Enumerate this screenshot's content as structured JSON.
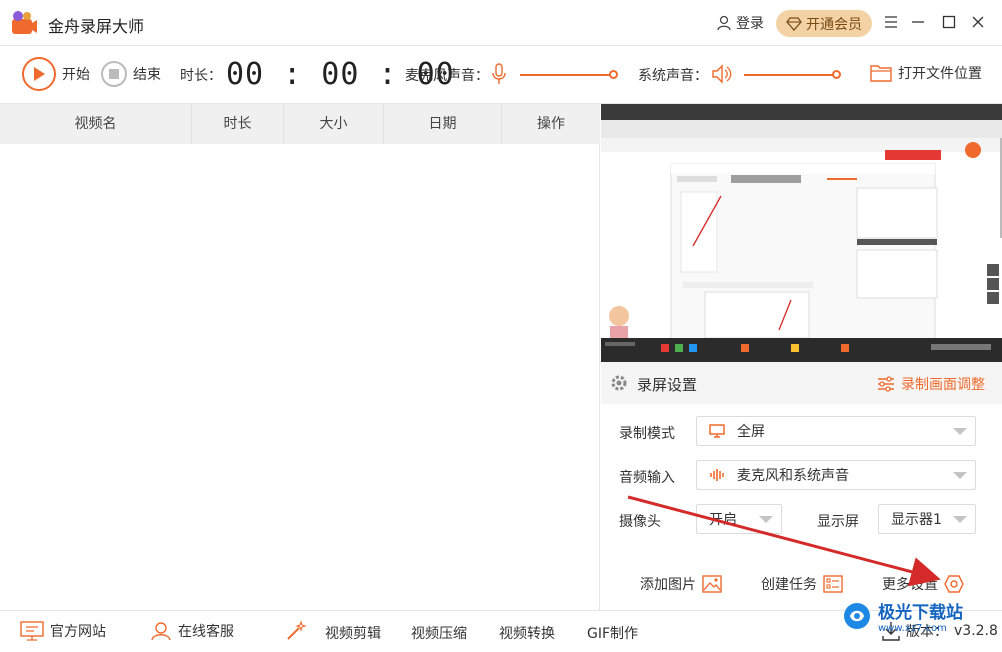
{
  "app": {
    "title": "金舟录屏大师",
    "version_label": "版本：",
    "version": "v3.2.8"
  },
  "titlebar": {
    "login": "登录",
    "vip": "开通会员"
  },
  "toolbar": {
    "start": "开始",
    "stop": "结束",
    "duration_label": "时长：",
    "timer": "00 : 00 : 00",
    "mic_label": "麦克风声音：",
    "system_sound_label": "系统声音：",
    "open_folder": "打开文件位置"
  },
  "table": {
    "columns": [
      "视频名",
      "时长",
      "大小",
      "日期",
      "操作"
    ]
  },
  "settings": {
    "title": "录屏设置",
    "adjust": "录制画面调整",
    "record_mode_label": "录制模式",
    "record_mode_value": "全屏",
    "audio_input_label": "音频输入",
    "audio_input_value": "麦克风和系统声音",
    "camera_label": "摄像头",
    "camera_value": "开启",
    "display_label": "显示屏",
    "display_value": "显示器1",
    "add_image": "添加图片",
    "create_task": "创建任务",
    "more_settings": "更多设置"
  },
  "bottom": {
    "website": "官方网站",
    "support": "在线客服",
    "video_edit": "视频剪辑",
    "video_compress": "视频压缩",
    "video_convert": "视频转换",
    "gif": "GIF制作"
  },
  "watermark": {
    "text": "极光下载站",
    "url": "www.xz7.com"
  },
  "colors": {
    "accent": "#f06a2d",
    "vip_bg": "#f3d3a6",
    "arrow": "#d42a2a"
  }
}
